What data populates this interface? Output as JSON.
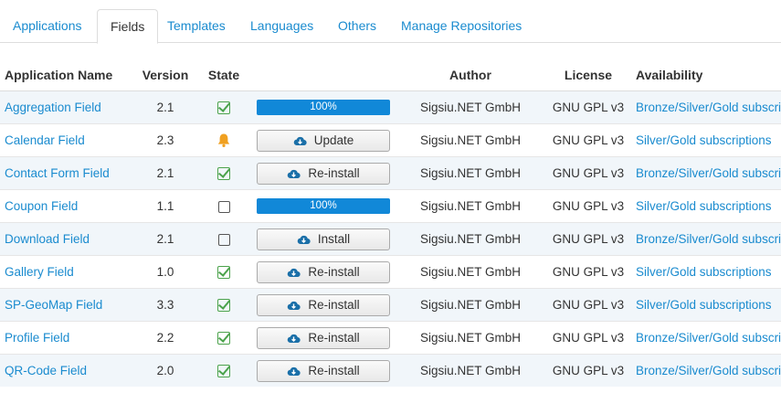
{
  "tabs": [
    {
      "label": "Applications",
      "active": false
    },
    {
      "label": "Fields",
      "active": true
    },
    {
      "label": "Templates",
      "active": false
    },
    {
      "label": "Languages",
      "active": false
    },
    {
      "label": "Others",
      "active": false
    },
    {
      "label": "Manage Repositories",
      "active": false
    }
  ],
  "table": {
    "headers": {
      "name": "Application Name",
      "version": "Version",
      "state": "State",
      "action": "",
      "author": "Author",
      "license": "License",
      "availability": "Availability"
    },
    "rows": [
      {
        "name": "Aggregation Field",
        "version": "2.1",
        "state": "installed",
        "action_type": "progress",
        "action": "100%",
        "author": "Sigsiu.NET GmbH",
        "license": "GNU GPL v3",
        "availability": "Bronze/Silver/Gold subscriptions"
      },
      {
        "name": "Calendar Field",
        "version": "2.3",
        "state": "update",
        "action_type": "button",
        "action": "Update",
        "author": "Sigsiu.NET GmbH",
        "license": "GNU GPL v3",
        "availability": "Silver/Gold subscriptions"
      },
      {
        "name": "Contact Form Field",
        "version": "2.1",
        "state": "installed",
        "action_type": "button",
        "action": "Re-install",
        "author": "Sigsiu.NET GmbH",
        "license": "GNU GPL v3",
        "availability": "Bronze/Silver/Gold subscriptions"
      },
      {
        "name": "Coupon Field",
        "version": "1.1",
        "state": "not-installed",
        "action_type": "progress",
        "action": "100%",
        "author": "Sigsiu.NET GmbH",
        "license": "GNU GPL v3",
        "availability": "Silver/Gold subscriptions"
      },
      {
        "name": "Download Field",
        "version": "2.1",
        "state": "not-installed",
        "action_type": "button",
        "action": "Install",
        "author": "Sigsiu.NET GmbH",
        "license": "GNU GPL v3",
        "availability": "Bronze/Silver/Gold subscriptions"
      },
      {
        "name": "Gallery Field",
        "version": "1.0",
        "state": "installed",
        "action_type": "button",
        "action": "Re-install",
        "author": "Sigsiu.NET GmbH",
        "license": "GNU GPL v3",
        "availability": "Silver/Gold subscriptions"
      },
      {
        "name": "SP-GeoMap Field",
        "version": "3.3",
        "state": "installed",
        "action_type": "button",
        "action": "Re-install",
        "author": "Sigsiu.NET GmbH",
        "license": "GNU GPL v3",
        "availability": "Silver/Gold subscriptions"
      },
      {
        "name": "Profile Field",
        "version": "2.2",
        "state": "installed",
        "action_type": "button",
        "action": "Re-install",
        "author": "Sigsiu.NET GmbH",
        "license": "GNU GPL v3",
        "availability": "Bronze/Silver/Gold subscriptions"
      },
      {
        "name": "QR-Code Field",
        "version": "2.0",
        "state": "installed",
        "action_type": "button",
        "action": "Re-install",
        "author": "Sigsiu.NET GmbH",
        "license": "GNU GPL v3",
        "availability": "Bronze/Silver/Gold subscriptions"
      }
    ]
  },
  "colors": {
    "link": "#1a8bcf",
    "progress": "#1188d8",
    "check": "#4ca34c",
    "bell": "#f0a020"
  }
}
